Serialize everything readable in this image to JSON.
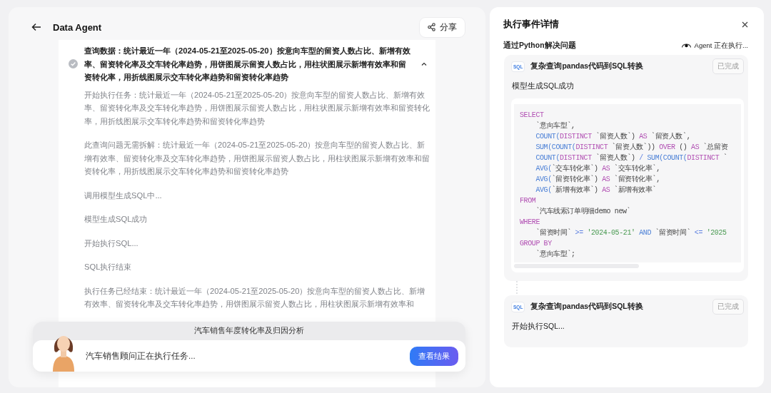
{
  "header": {
    "title": "Data Agent",
    "share_button": "分享"
  },
  "step": {
    "title": "查询数据：统计最近一年（2024-05-21至2025-05-20）按意向车型的留资人数占比、新增有效率、留资转化率及交车转化率趋势，用饼图展示留资人数占比，用柱状图展示新增有效率和留资转化率，用折线图展示交车转化率趋势和留资转化率趋势",
    "done": true,
    "expanded": true,
    "logs": [
      "开始执行任务：统计最近一年（2024-05-21至2025-05-20）按意向车型的留资人数占比、新增有效率、留资转化率及交车转化率趋势，用饼图展示留资人数占比，用柱状图展示新增有效率和留资转化率，用折线图展示交车转化率趋势和留资转化率趋势",
      "此查询问题无需拆解：统计最近一年（2024-05-21至2025-05-20）按意向车型的留资人数占比、新增有效率、留资转化率及交车转化率趋势，用饼图展示留资人数占比，用柱状图展示新增有效率和留资转化率，用折线图展示交车转化率趋势和留资转化率趋势",
      "调用模型生成SQL中...",
      "模型生成SQL成功",
      "开始执行SQL...",
      "SQL执行结束",
      "执行任务已经结束：统计最近一年（2024-05-21至2025-05-20）按意向车型的留资人数占比、新增有效率、留资转化率及交车转化率趋势，用饼图展示留资人数占比，用柱状图展示新增有效率和"
    ]
  },
  "task_bar": {
    "title": "汽车销售年度转化率及归因分析",
    "status": "汽车销售顾问正在执行任务...",
    "button": "查看结果"
  },
  "detail_panel": {
    "title": "执行事件详情",
    "subtitle": "通过Python解决问题",
    "agent_status": "Agent 正在执行...",
    "events": [
      {
        "badge": "SQL",
        "title": "复杂查询pandas代码到SQL转换",
        "status": "已完成",
        "message": "模型生成SQL成功",
        "code": [
          [
            {
              "kind": "kw",
              "text": "SELECT"
            }
          ],
          [
            {
              "kind": "plain",
              "text": "    `意向车型`,"
            }
          ],
          [
            {
              "kind": "fn",
              "text": "    COUNT("
            },
            {
              "kind": "kw",
              "text": "DISTINCT"
            },
            {
              "kind": "plain",
              "text": " `留资人数`) "
            },
            {
              "kind": "kw",
              "text": "AS"
            },
            {
              "kind": "plain",
              "text": " `留资人数`,"
            }
          ],
          [
            {
              "kind": "fn",
              "text": "    SUM(COUNT("
            },
            {
              "kind": "kw",
              "text": "DISTINCT"
            },
            {
              "kind": "plain",
              "text": " `留资人数`)) "
            },
            {
              "kind": "kw",
              "text": "OVER"
            },
            {
              "kind": "plain",
              "text": " () "
            },
            {
              "kind": "kw",
              "text": "AS"
            },
            {
              "kind": "plain",
              "text": " `总留资"
            }
          ],
          [
            {
              "kind": "fn",
              "text": "    COUNT("
            },
            {
              "kind": "kw",
              "text": "DISTINCT"
            },
            {
              "kind": "plain",
              "text": " `留资人数`) "
            },
            {
              "kind": "op",
              "text": "/"
            },
            {
              "kind": "fn",
              "text": " SUM(COUNT("
            },
            {
              "kind": "kw",
              "text": "DISTINCT"
            },
            {
              "kind": "plain",
              "text": " `"
            }
          ],
          [
            {
              "kind": "fn",
              "text": "    AVG("
            },
            {
              "kind": "plain",
              "text": "`交车转化率`) "
            },
            {
              "kind": "kw",
              "text": "AS"
            },
            {
              "kind": "plain",
              "text": " `交车转化率`,"
            }
          ],
          [
            {
              "kind": "fn",
              "text": "    AVG("
            },
            {
              "kind": "plain",
              "text": "`留资转化率`) "
            },
            {
              "kind": "kw",
              "text": "AS"
            },
            {
              "kind": "plain",
              "text": " `留资转化率`,"
            }
          ],
          [
            {
              "kind": "fn",
              "text": "    AVG("
            },
            {
              "kind": "plain",
              "text": "`新增有效率`) "
            },
            {
              "kind": "kw",
              "text": "AS"
            },
            {
              "kind": "plain",
              "text": " `新增有效率`"
            }
          ],
          [
            {
              "kind": "kw",
              "text": "FROM"
            }
          ],
          [
            {
              "kind": "plain",
              "text": "    `汽车线索订单明细demo new`"
            }
          ],
          [
            {
              "kind": "kw",
              "text": "WHERE"
            }
          ],
          [
            {
              "kind": "plain",
              "text": "    `留资时间` "
            },
            {
              "kind": "op",
              "text": ">="
            },
            {
              "kind": "str",
              "text": " '2024-05-21'"
            },
            {
              "kind": "fn",
              "text": " AND"
            },
            {
              "kind": "plain",
              "text": " `留资时间` "
            },
            {
              "kind": "op",
              "text": "<="
            },
            {
              "kind": "str",
              "text": " '2025"
            }
          ],
          [
            {
              "kind": "kw",
              "text": "GROUP BY"
            }
          ],
          [
            {
              "kind": "plain",
              "text": "    `意向车型`;"
            }
          ]
        ]
      },
      {
        "badge": "SQL",
        "title": "复杂查询pandas代码到SQL转换",
        "status": "已完成",
        "message": "开始执行SQL..."
      }
    ]
  }
}
